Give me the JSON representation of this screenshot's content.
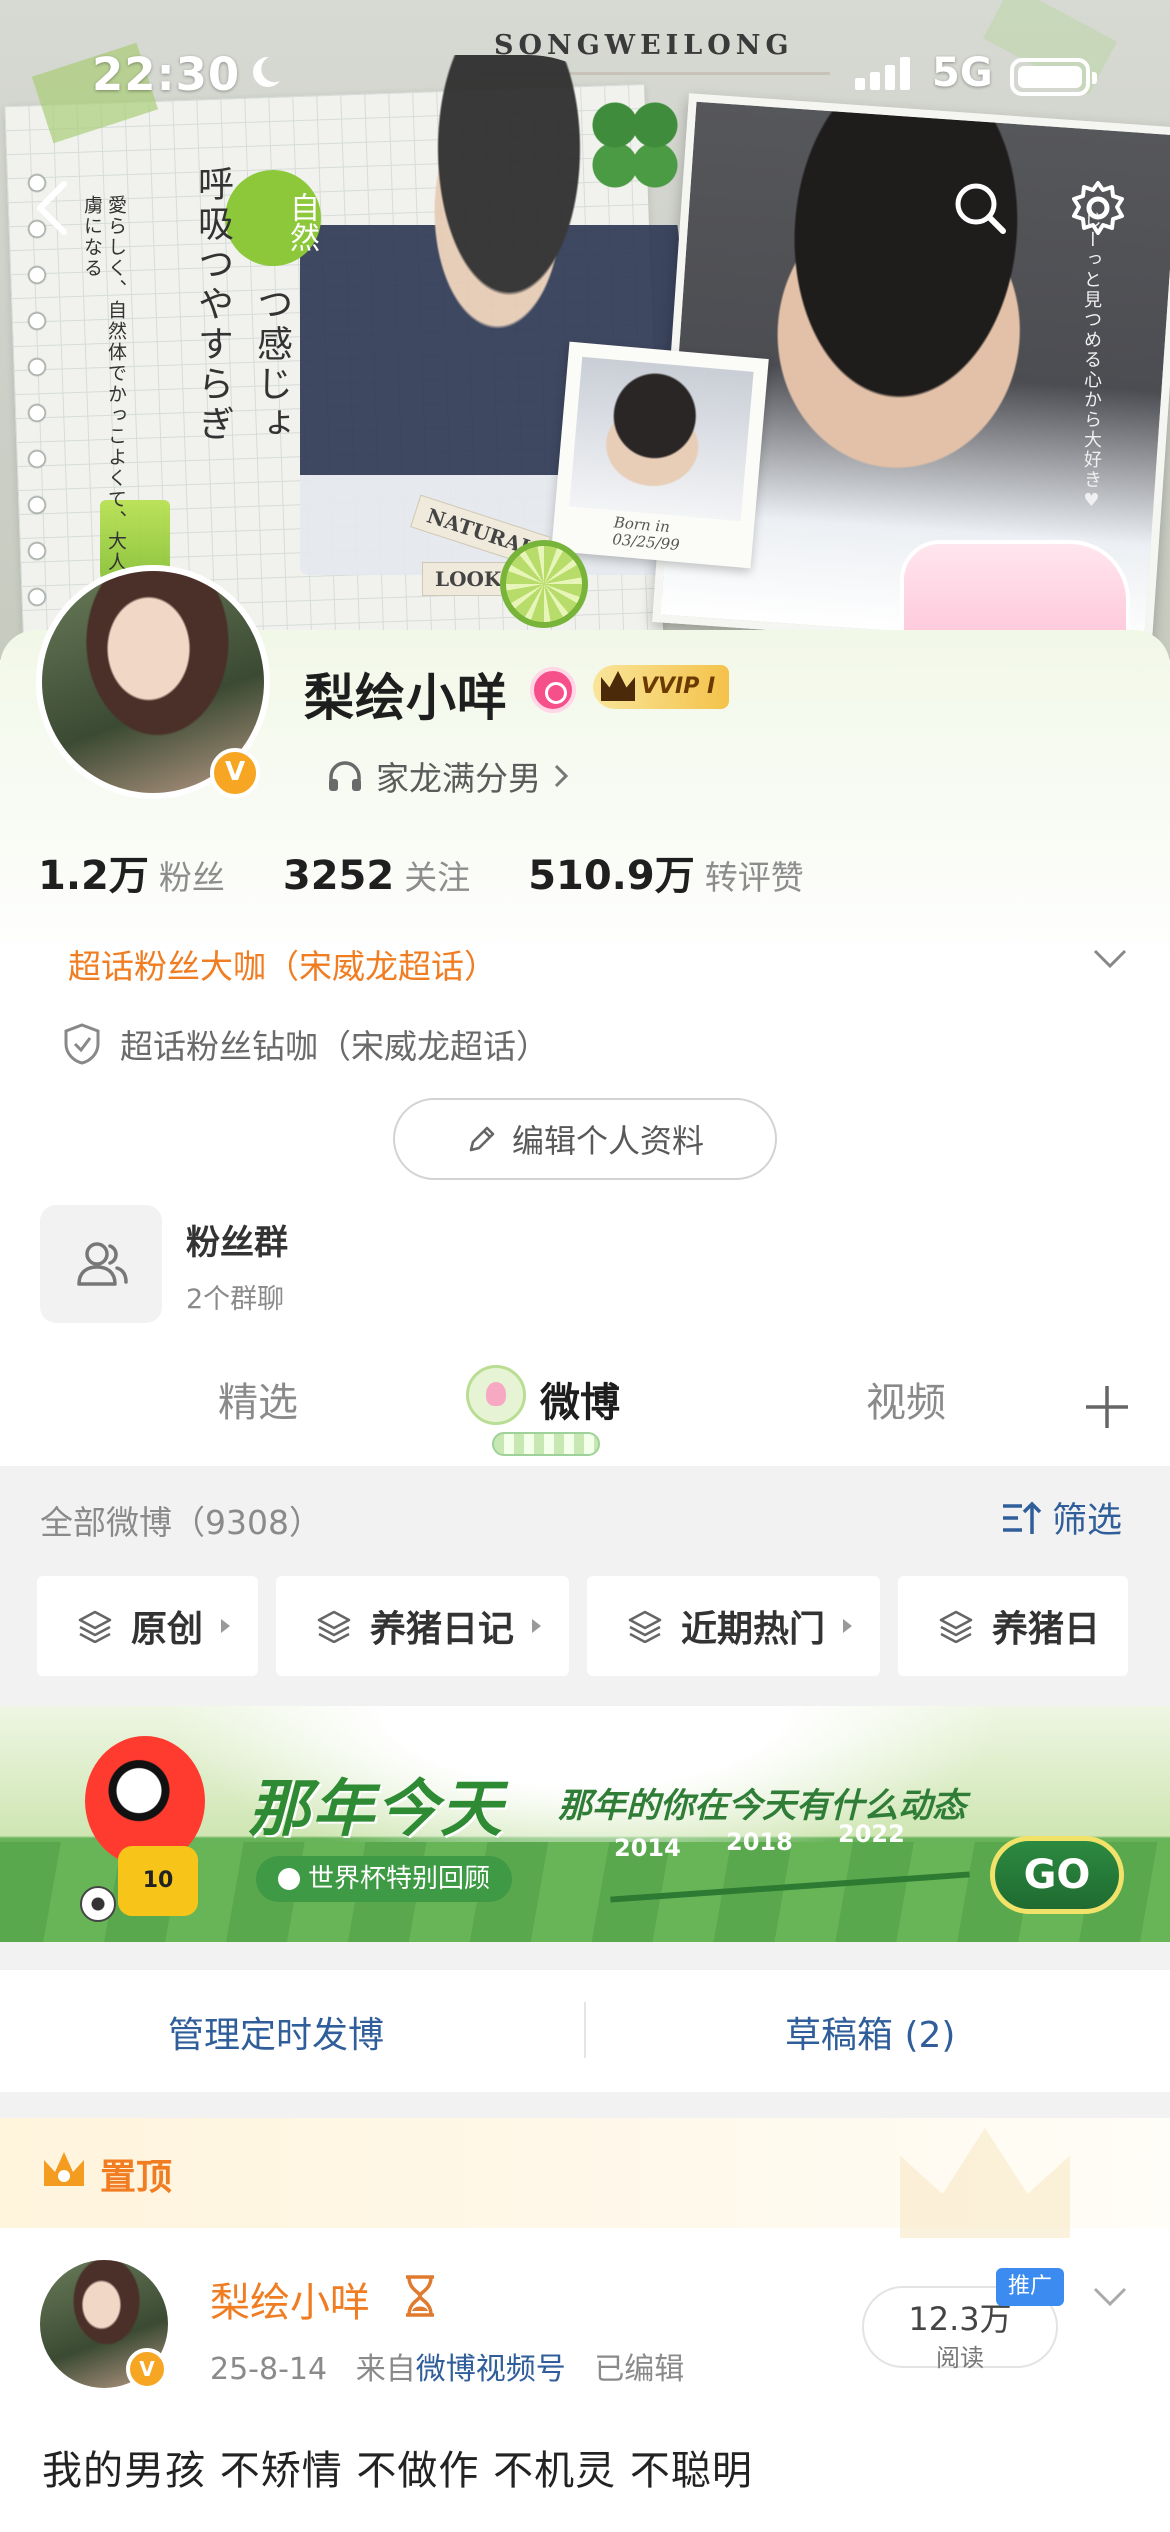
{
  "status_bar": {
    "time": "22:30",
    "network": "5G"
  },
  "hero": {
    "banner_word": "SONGWEILONG",
    "vertical_text_1": "呼吸つやすらぎ",
    "vertical_text_2": "つ感じょ",
    "badge_text": "自然",
    "side_text": "愛らしく、自然体でかっこよくて、大人気誰もが虜になる",
    "right_text": "じーっと見つめる心から大好き♥",
    "tag_1": "NATURAL",
    "tag_2": "LOOK",
    "polaroid_caption": "Born in\n03/25/99"
  },
  "profile": {
    "name": "梨绘小咩",
    "vip_label": "VVIP I",
    "music_label": "家龙满分男",
    "stats": [
      {
        "value": "1.2万",
        "label": "粉丝"
      },
      {
        "value": "3252",
        "label": "关注"
      },
      {
        "value": "510.9万",
        "label": "转评赞"
      }
    ],
    "fan_title": "超话粉丝大咖（宋威龙超话）",
    "fan_subtitle": "超话粉丝钻咖（宋威龙超话）",
    "edit_button": "编辑个人资料",
    "group": {
      "title": "粉丝群",
      "subtitle": "2个群聊"
    }
  },
  "tabs": {
    "featured": "精选",
    "weibo": "微博",
    "video": "视频"
  },
  "feed": {
    "all_posts": "全部微博（9308）",
    "filter": "筛选",
    "categories": [
      "原创",
      "养猪日记",
      "近期热门",
      "养猪日"
    ]
  },
  "banner": {
    "title": "那年今天",
    "subtitle": "那年的你在今天有什么动态",
    "pill": "世界杯特别回顾",
    "years": [
      "2014",
      "2018",
      "2022"
    ],
    "go": "GO",
    "jersey_number": "10"
  },
  "manage": {
    "scheduled": "管理定时发博",
    "drafts": "草稿箱 (2)"
  },
  "post": {
    "pinned_label": "置顶",
    "author": "梨绘小咩",
    "date": "25-8-14",
    "source_prefix": "来自",
    "source": "微博视频号",
    "edited": "已编辑",
    "reads_value": "12.3万",
    "reads_label": "阅读",
    "promo": "推广",
    "text": "我的男孩 不矫情 不做作 不机灵 不聪明"
  },
  "colors": {
    "accent_orange": "#f07d22",
    "link_blue": "#2f5e9a",
    "vip_gold": "#f4c24a"
  }
}
